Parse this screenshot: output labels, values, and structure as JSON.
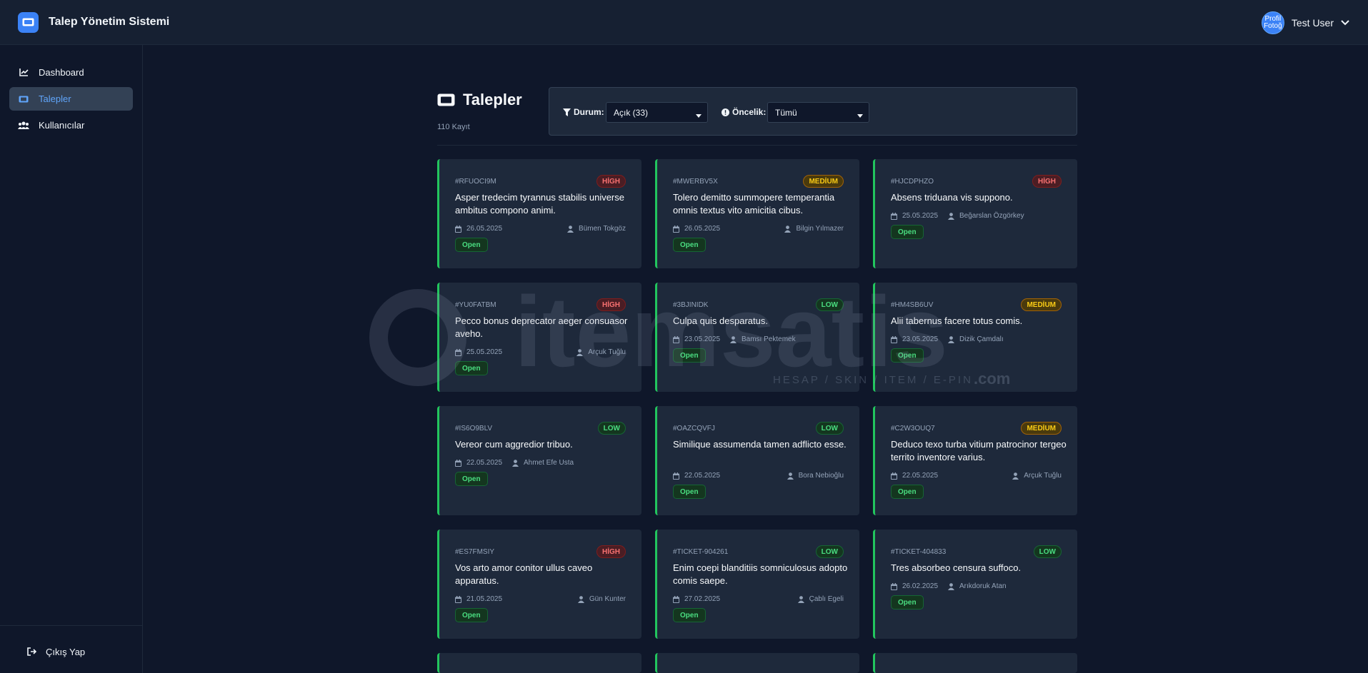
{
  "app": {
    "title": "Talep Yönetim Sistemi"
  },
  "user": {
    "name": "Test User",
    "avatar_alt": "Profil Fotoğ"
  },
  "sidebar": {
    "items": [
      {
        "label": "Dashboard",
        "icon": "chart-line-icon"
      },
      {
        "label": "Talepler",
        "icon": "ticket-icon",
        "active": true
      },
      {
        "label": "Kullanıcılar",
        "icon": "users-icon"
      }
    ],
    "logout_label": "Çıkış Yap"
  },
  "page": {
    "title": "Talepler",
    "record_count": "110 Kayıt"
  },
  "filters": {
    "status_label": "Durum:",
    "status_value": "Açık (33)",
    "priority_label": "Öncelik:",
    "priority_value": "Tümü"
  },
  "watermark": {
    "text": "itemsatis",
    "tagline": "HESAP / SKIN / ITEM / E-PIN",
    "suffix": ".com"
  },
  "tickets": [
    {
      "id": "#RFUOCI9M",
      "priority": "HİGH",
      "level": "high",
      "title": "Asper tredecim tyrannus stabilis universe ambitus compono animi.",
      "date": "26.05.2025",
      "user": "Bümen Tokgöz",
      "status": "Open"
    },
    {
      "id": "#MWERBV5X",
      "priority": "MEDİUM",
      "level": "medium",
      "title": "Tolero demitto summopere temperantia omnis textus vito amicitia cibus.",
      "date": "26.05.2025",
      "user": "Bilgin Yılmazer",
      "status": "Open"
    },
    {
      "id": "#HJCDPHZO",
      "priority": "HİGH",
      "level": "high",
      "title": "Absens triduana vis suppono.",
      "date": "25.05.2025",
      "user": "Beğarslan Özgörkey",
      "status": "Open"
    },
    {
      "id": "#YU0FATBM",
      "priority": "HİGH",
      "level": "high",
      "title": "Pecco bonus deprecator aeger consuasor aveho.",
      "date": "25.05.2025",
      "user": "Arçuk Tuğlu",
      "status": "Open"
    },
    {
      "id": "#3BJINIDK",
      "priority": "LOW",
      "level": "low",
      "title": "Culpa quis desparatus.",
      "date": "23.05.2025",
      "user": "Bamsı Pektemek",
      "status": "Open"
    },
    {
      "id": "#HM4SB6UV",
      "priority": "MEDİUM",
      "level": "medium",
      "title": "Alii tabernus facere totus comis.",
      "date": "23.05.2025",
      "user": "Dizik Çamdalı",
      "status": "Open"
    },
    {
      "id": "#IS6O9BLV",
      "priority": "LOW",
      "level": "low",
      "title": "Vereor cum aggredior tribuo.",
      "date": "22.05.2025",
      "user": "Ahmet Efe Usta",
      "status": "Open"
    },
    {
      "id": "#OAZCQVFJ",
      "priority": "LOW",
      "level": "low",
      "title": "Similique assumenda tamen adflicto esse.",
      "date": "22.05.2025",
      "user": "Bora Nebioğlu",
      "status": "Open"
    },
    {
      "id": "#C2W3OUQ7",
      "priority": "MEDİUM",
      "level": "medium",
      "title": "Deduco texo turba vitium patrocinor tergeo territo inventore varius.",
      "date": "22.05.2025",
      "user": "Arçuk Tuğlu",
      "status": "Open"
    },
    {
      "id": "#ES7FMSIY",
      "priority": "HİGH",
      "level": "high",
      "title": "Vos arto amor conitor ullus caveo apparatus.",
      "date": "21.05.2025",
      "user": "Gün Kunter",
      "status": "Open"
    },
    {
      "id": "#TICKET-904261",
      "priority": "LOW",
      "level": "low",
      "title": "Enim coepi blanditiis somniculosus adopto comis saepe.",
      "date": "27.02.2025",
      "user": "Çablı Egeli",
      "status": "Open"
    },
    {
      "id": "#TICKET-404833",
      "priority": "LOW",
      "level": "low",
      "title": "Tres absorbeo censura suffoco.",
      "date": "26.02.2025",
      "user": "Arıkdoruk Atan",
      "status": "Open"
    }
  ]
}
